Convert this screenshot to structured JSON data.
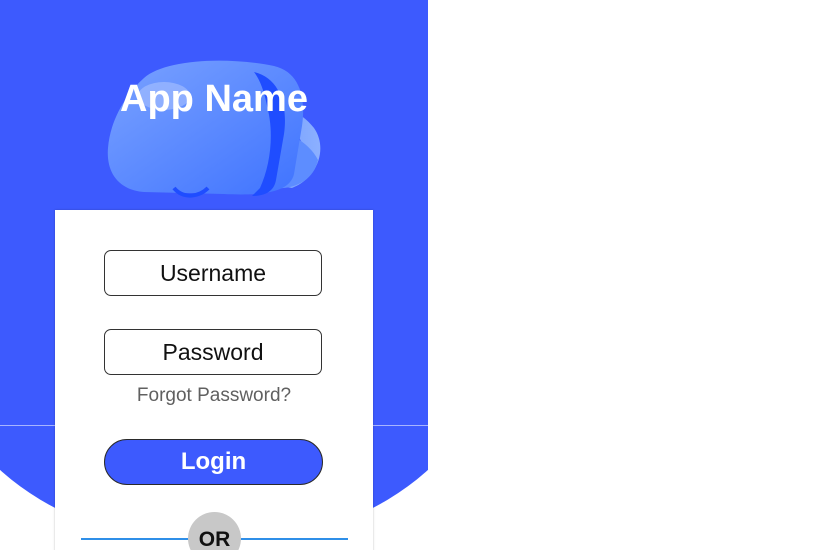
{
  "app": {
    "title": "App Name",
    "logo_icon": "vr-headset-icon"
  },
  "colors": {
    "brand": "#3d5afe",
    "divider": "#2f8fe8",
    "or_badge": "#c8c8c8"
  },
  "login_form": {
    "username_placeholder": "Username",
    "password_placeholder": "Password",
    "forgot_password_label": "Forgot Password?",
    "login_label": "Login",
    "separator_label": "OR"
  }
}
